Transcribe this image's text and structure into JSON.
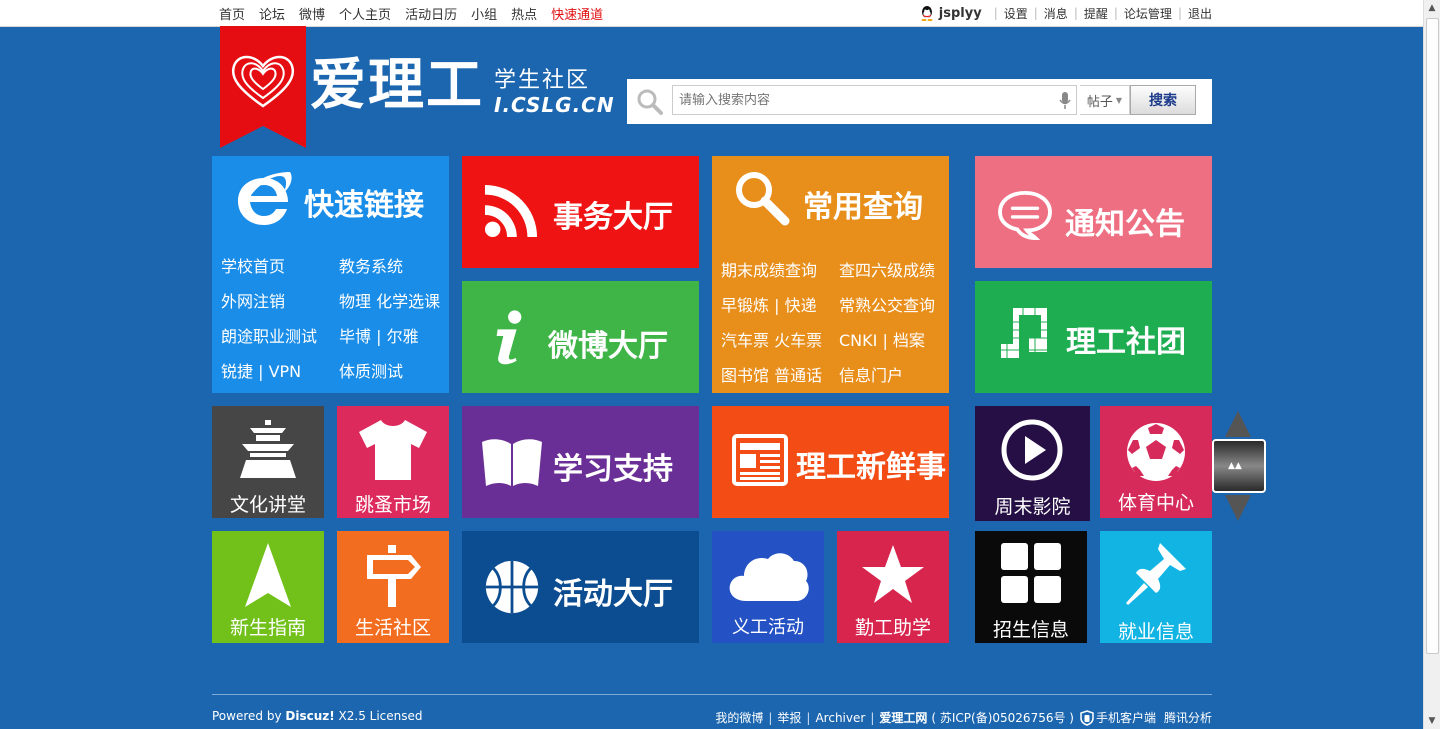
{
  "topnav": [
    "首页",
    "论坛",
    "微博",
    "个人主页",
    "活动日历",
    "小组",
    "热点",
    "快速通道"
  ],
  "user": {
    "name": "jsplyy",
    "links": [
      "设置",
      "消息",
      "提醒",
      "论坛管理",
      "退出"
    ]
  },
  "logo": {
    "title": "爱理工",
    "subtitle": "学生社区",
    "url": "I.CSLG.CN"
  },
  "search": {
    "placeholder": "请输入搜索内容",
    "type": "帖子",
    "button": "搜索"
  },
  "tiles": {
    "quicklinks": {
      "title": "快速链接",
      "links": [
        "学校首页",
        "教务系统",
        "外网注销",
        "物理 化学选课",
        "朗途职业测试",
        "毕博 | 尔雅",
        "锐捷 | VPN",
        "体质测试"
      ]
    },
    "affairs": {
      "title": "事务大厅"
    },
    "query": {
      "title": "常用查询",
      "links": [
        "期末成绩查询",
        "查四六级成绩",
        "早锻炼 | 快递",
        "常熟公交查询",
        "汽车票 火车票",
        "CNKI | 档案",
        "图书馆 普通话",
        "信息门户"
      ]
    },
    "notice": {
      "title": "通知公告"
    },
    "weibo": {
      "title": "微博大厅"
    },
    "clubs": {
      "title": "理工社团"
    },
    "culture": {
      "label": "文化讲堂"
    },
    "flea": {
      "label": "跳蚤市场"
    },
    "study": {
      "title": "学习支持"
    },
    "news": {
      "title": "理工新鲜事"
    },
    "movie": {
      "label": "周末影院"
    },
    "sports": {
      "label": "体育中心"
    },
    "freshman": {
      "label": "新生指南"
    },
    "life": {
      "label": "生活社区"
    },
    "activity": {
      "title": "活动大厅"
    },
    "volunteer": {
      "label": "义工活动"
    },
    "workstudy": {
      "label": "勤工助学"
    },
    "admission": {
      "label": "招生信息"
    },
    "jobs": {
      "label": "就业信息"
    }
  },
  "footer": {
    "powered_prefix": "Powered by ",
    "powered_brand": "Discuz!",
    "powered_suffix": " X2.5 Licensed",
    "links": [
      "我的微博",
      "举报",
      "Archiver"
    ],
    "site": "爱理工网",
    "icp": "( 苏ICP(备)05026756号 )",
    "mobile": "手机客户端",
    "analytics": "腾讯分析"
  },
  "colors": {
    "background": "#1c66af",
    "quicklinks": "#1a8de8",
    "affairs": "#ef1313",
    "query": "#e88e1b",
    "notice": "#ef6f82",
    "weibo": "#3fb548",
    "clubs": "#1fad52",
    "culture": "#464646",
    "flea": "#dc2a5c",
    "study": "#6a2f96",
    "news": "#f34c14",
    "movie": "#250f45",
    "sports": "#d62a5b",
    "freshman": "#71c11a",
    "life": "#f26d1f",
    "activity": "#0b4d90",
    "volunteer": "#2452c4",
    "workstudy": "#d7254e",
    "admission": "#0a0a0a",
    "jobs": "#11b4e3"
  },
  "icons": [
    "qq-icon",
    "search-icon",
    "mic-icon",
    "ie-icon",
    "rss-icon",
    "magnifier-icon",
    "chat-bubble-icon",
    "info-icon",
    "music-note-icon",
    "temple-icon",
    "tshirt-icon",
    "book-icon",
    "newspaper-icon",
    "play-icon",
    "soccer-ball-icon",
    "arrow-up-icon",
    "signpost-icon",
    "basketball-icon",
    "cloud-icon",
    "star-icon",
    "grid-icon",
    "pushpin-icon",
    "shield-icon"
  ]
}
